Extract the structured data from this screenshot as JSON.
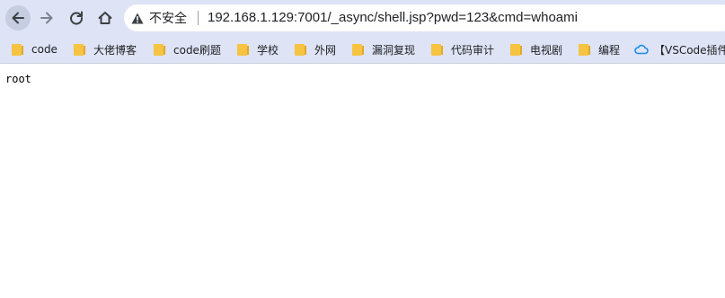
{
  "browser": {
    "security_label": "不安全",
    "url": "192.168.1.129:7001/_async/shell.jsp?pwd=123&cmd=whoami",
    "accent_color": "#dee3f5"
  },
  "bookmarks": {
    "items": [
      {
        "label": "code",
        "icon": "folder-icon"
      },
      {
        "label": "大佬博客",
        "icon": "folder-icon"
      },
      {
        "label": "code刷题",
        "icon": "folder-icon"
      },
      {
        "label": "学校",
        "icon": "folder-icon"
      },
      {
        "label": "外网",
        "icon": "folder-icon"
      },
      {
        "label": "漏洞复现",
        "icon": "folder-icon"
      },
      {
        "label": "代码审计",
        "icon": "folder-icon"
      },
      {
        "label": "电视剧",
        "icon": "folder-icon"
      },
      {
        "label": "编程",
        "icon": "folder-icon"
      },
      {
        "label": "【VSCode插件",
        "icon": "cloud-icon"
      }
    ]
  },
  "page": {
    "output_text": "root"
  }
}
